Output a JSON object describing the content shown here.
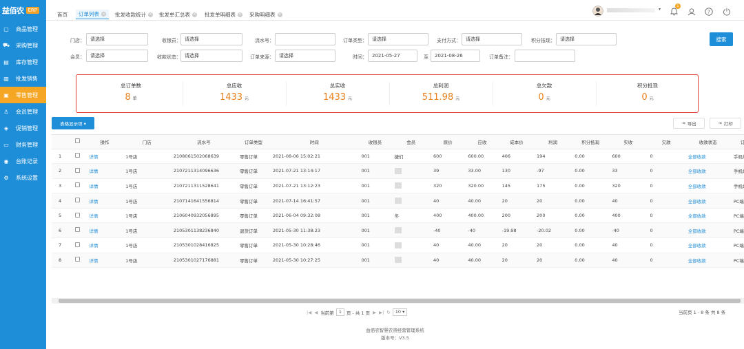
{
  "logo": {
    "name": "益佰农",
    "badge": "ERP"
  },
  "sidebar": {
    "items": [
      {
        "label": "商品管理",
        "icon": "box-icon",
        "active": false
      },
      {
        "label": "采购管理",
        "icon": "cart-icon",
        "active": false
      },
      {
        "label": "库存管理",
        "icon": "warehouse-icon",
        "active": false
      },
      {
        "label": "批发销售",
        "icon": "chart-icon",
        "active": false
      },
      {
        "label": "零售管理",
        "icon": "register-icon",
        "active": true
      },
      {
        "label": "会员管理",
        "icon": "user-icon",
        "active": false
      },
      {
        "label": "促销管理",
        "icon": "tag-icon",
        "active": false
      },
      {
        "label": "财务管理",
        "icon": "wallet-icon",
        "active": false
      },
      {
        "label": "台账记录",
        "icon": "ledger-icon",
        "active": false
      },
      {
        "label": "系统设置",
        "icon": "gear-icon",
        "active": false
      }
    ]
  },
  "tabs": [
    {
      "label": "首页",
      "closable": false
    },
    {
      "label": "订单列表",
      "closable": true,
      "active": true
    },
    {
      "label": "批发收款统计",
      "closable": true
    },
    {
      "label": "批发单汇总表",
      "closable": true
    },
    {
      "label": "批发单明细表",
      "closable": true
    },
    {
      "label": "采购明细表",
      "closable": true
    }
  ],
  "header": {
    "notification_count": "1"
  },
  "filters": {
    "store": {
      "label": "门店：",
      "value": "请选择"
    },
    "cashier": {
      "label": "收银员：",
      "value": "请选择"
    },
    "serial": {
      "label": "流水号：",
      "value": ""
    },
    "order_type": {
      "label": "订单类型：",
      "value": "请选择"
    },
    "pay_method": {
      "label": "支付方式：",
      "value": "请选择"
    },
    "points": {
      "label": "积分抵现：",
      "value": "请选择"
    },
    "member": {
      "label": "会员：",
      "value": "请选择"
    },
    "pay_status": {
      "label": "收款状态：",
      "value": "请选择"
    },
    "source": {
      "label": "订单来源：",
      "value": "请选择"
    },
    "time": {
      "label": "时间：",
      "from": "2021-05-27",
      "to_label": "至",
      "to": "2021-08-26"
    },
    "remark": {
      "label": "订单备注：",
      "value": ""
    },
    "search_label": "搜索"
  },
  "summary": [
    {
      "title": "总订单数",
      "value": "8",
      "unit": "单"
    },
    {
      "title": "总应收",
      "value": "1433",
      "unit": "元"
    },
    {
      "title": "总实收",
      "value": "1433",
      "unit": "元"
    },
    {
      "title": "总利润",
      "value": "511.98",
      "unit": "元"
    },
    {
      "title": "总欠款",
      "value": "0",
      "unit": "元"
    },
    {
      "title": "积分抵现",
      "value": "0",
      "unit": "元"
    }
  ],
  "toolbar": {
    "columns_label": "表格显示项 ▾",
    "export_label": "导出",
    "print_label": "打印"
  },
  "table": {
    "headers": [
      "操作",
      "门店",
      "流水号",
      "订单类型",
      "时间",
      "收银员",
      "会员",
      "原价",
      "应收",
      "成本价",
      "利润",
      "积分抵现",
      "实收",
      "欠款",
      "收款状态",
      "订单来源"
    ],
    "rows": [
      [
        "详情",
        "1号店",
        "2108061502068639",
        "零售订单",
        "2021-08-06 15:02:21",
        "001",
        "捷们",
        "600",
        "600.00",
        "406",
        "194",
        "0.00",
        "600",
        "0",
        "全部收款",
        "手机端"
      ],
      [
        "详情",
        "1号店",
        "2107211314096636",
        "零售订单",
        "2021-07-21 13:14:17",
        "001",
        "",
        "39",
        "33.00",
        "130",
        "-97",
        "0.00",
        "33",
        "0",
        "全部收款",
        "手机端"
      ],
      [
        "详情",
        "1号店",
        "2107211311528641",
        "零售订单",
        "2021-07-21 13:12:23",
        "001",
        "",
        "320",
        "320.00",
        "145",
        "175",
        "0.00",
        "320",
        "0",
        "全部收款",
        "手机端"
      ],
      [
        "详情",
        "1号店",
        "2107141641556814",
        "零售订单",
        "2021-07-14 16:41:57",
        "001",
        "",
        "40",
        "40.00",
        "20",
        "20",
        "0.00",
        "40",
        "0",
        "全部收款",
        "PC端"
      ],
      [
        "详情",
        "1号店",
        "2106040932056895",
        "零售订单",
        "2021-06-04 09:32:08",
        "001",
        "冬",
        "400",
        "400.00",
        "200",
        "200",
        "0.00",
        "400",
        "0",
        "全部收款",
        "PC端"
      ],
      [
        "详情",
        "1号店",
        "2105301138236840",
        "退货订单",
        "2021-05-30 11:38:23",
        "001",
        "",
        "-40",
        "-40",
        "-19.98",
        "-20.02",
        "0.00",
        "-40",
        "0",
        "全部收款",
        "PC端"
      ],
      [
        "详情",
        "1号店",
        "2105301028416825",
        "零售订单",
        "2021-05-30 10:28:46",
        "001",
        "",
        "40",
        "40.00",
        "20",
        "20",
        "0.00",
        "40",
        "0",
        "全部收款",
        "PC端"
      ],
      [
        "详情",
        "1号店",
        "2105301027176881",
        "零售订单",
        "2021-05-30 10:27:25",
        "001",
        "",
        "40",
        "40.00",
        "20",
        "20",
        "0.00",
        "40",
        "0",
        "全部收款",
        "PC端"
      ]
    ]
  },
  "pager": {
    "page_prefix": "当前第",
    "page": "1",
    "page_suffix": "页 - 共 1 页",
    "page_size": "10",
    "summary": "当前页 1 - 8 条  共 8 条"
  },
  "footer": {
    "line1": "益佰农智慧农资经营管理系统",
    "line2": "版本号：V3.5"
  },
  "colors": {
    "primary": "#1f8ed8",
    "accent": "#f5a623",
    "value": "#e8801c",
    "highlight_border": "#e53935"
  }
}
